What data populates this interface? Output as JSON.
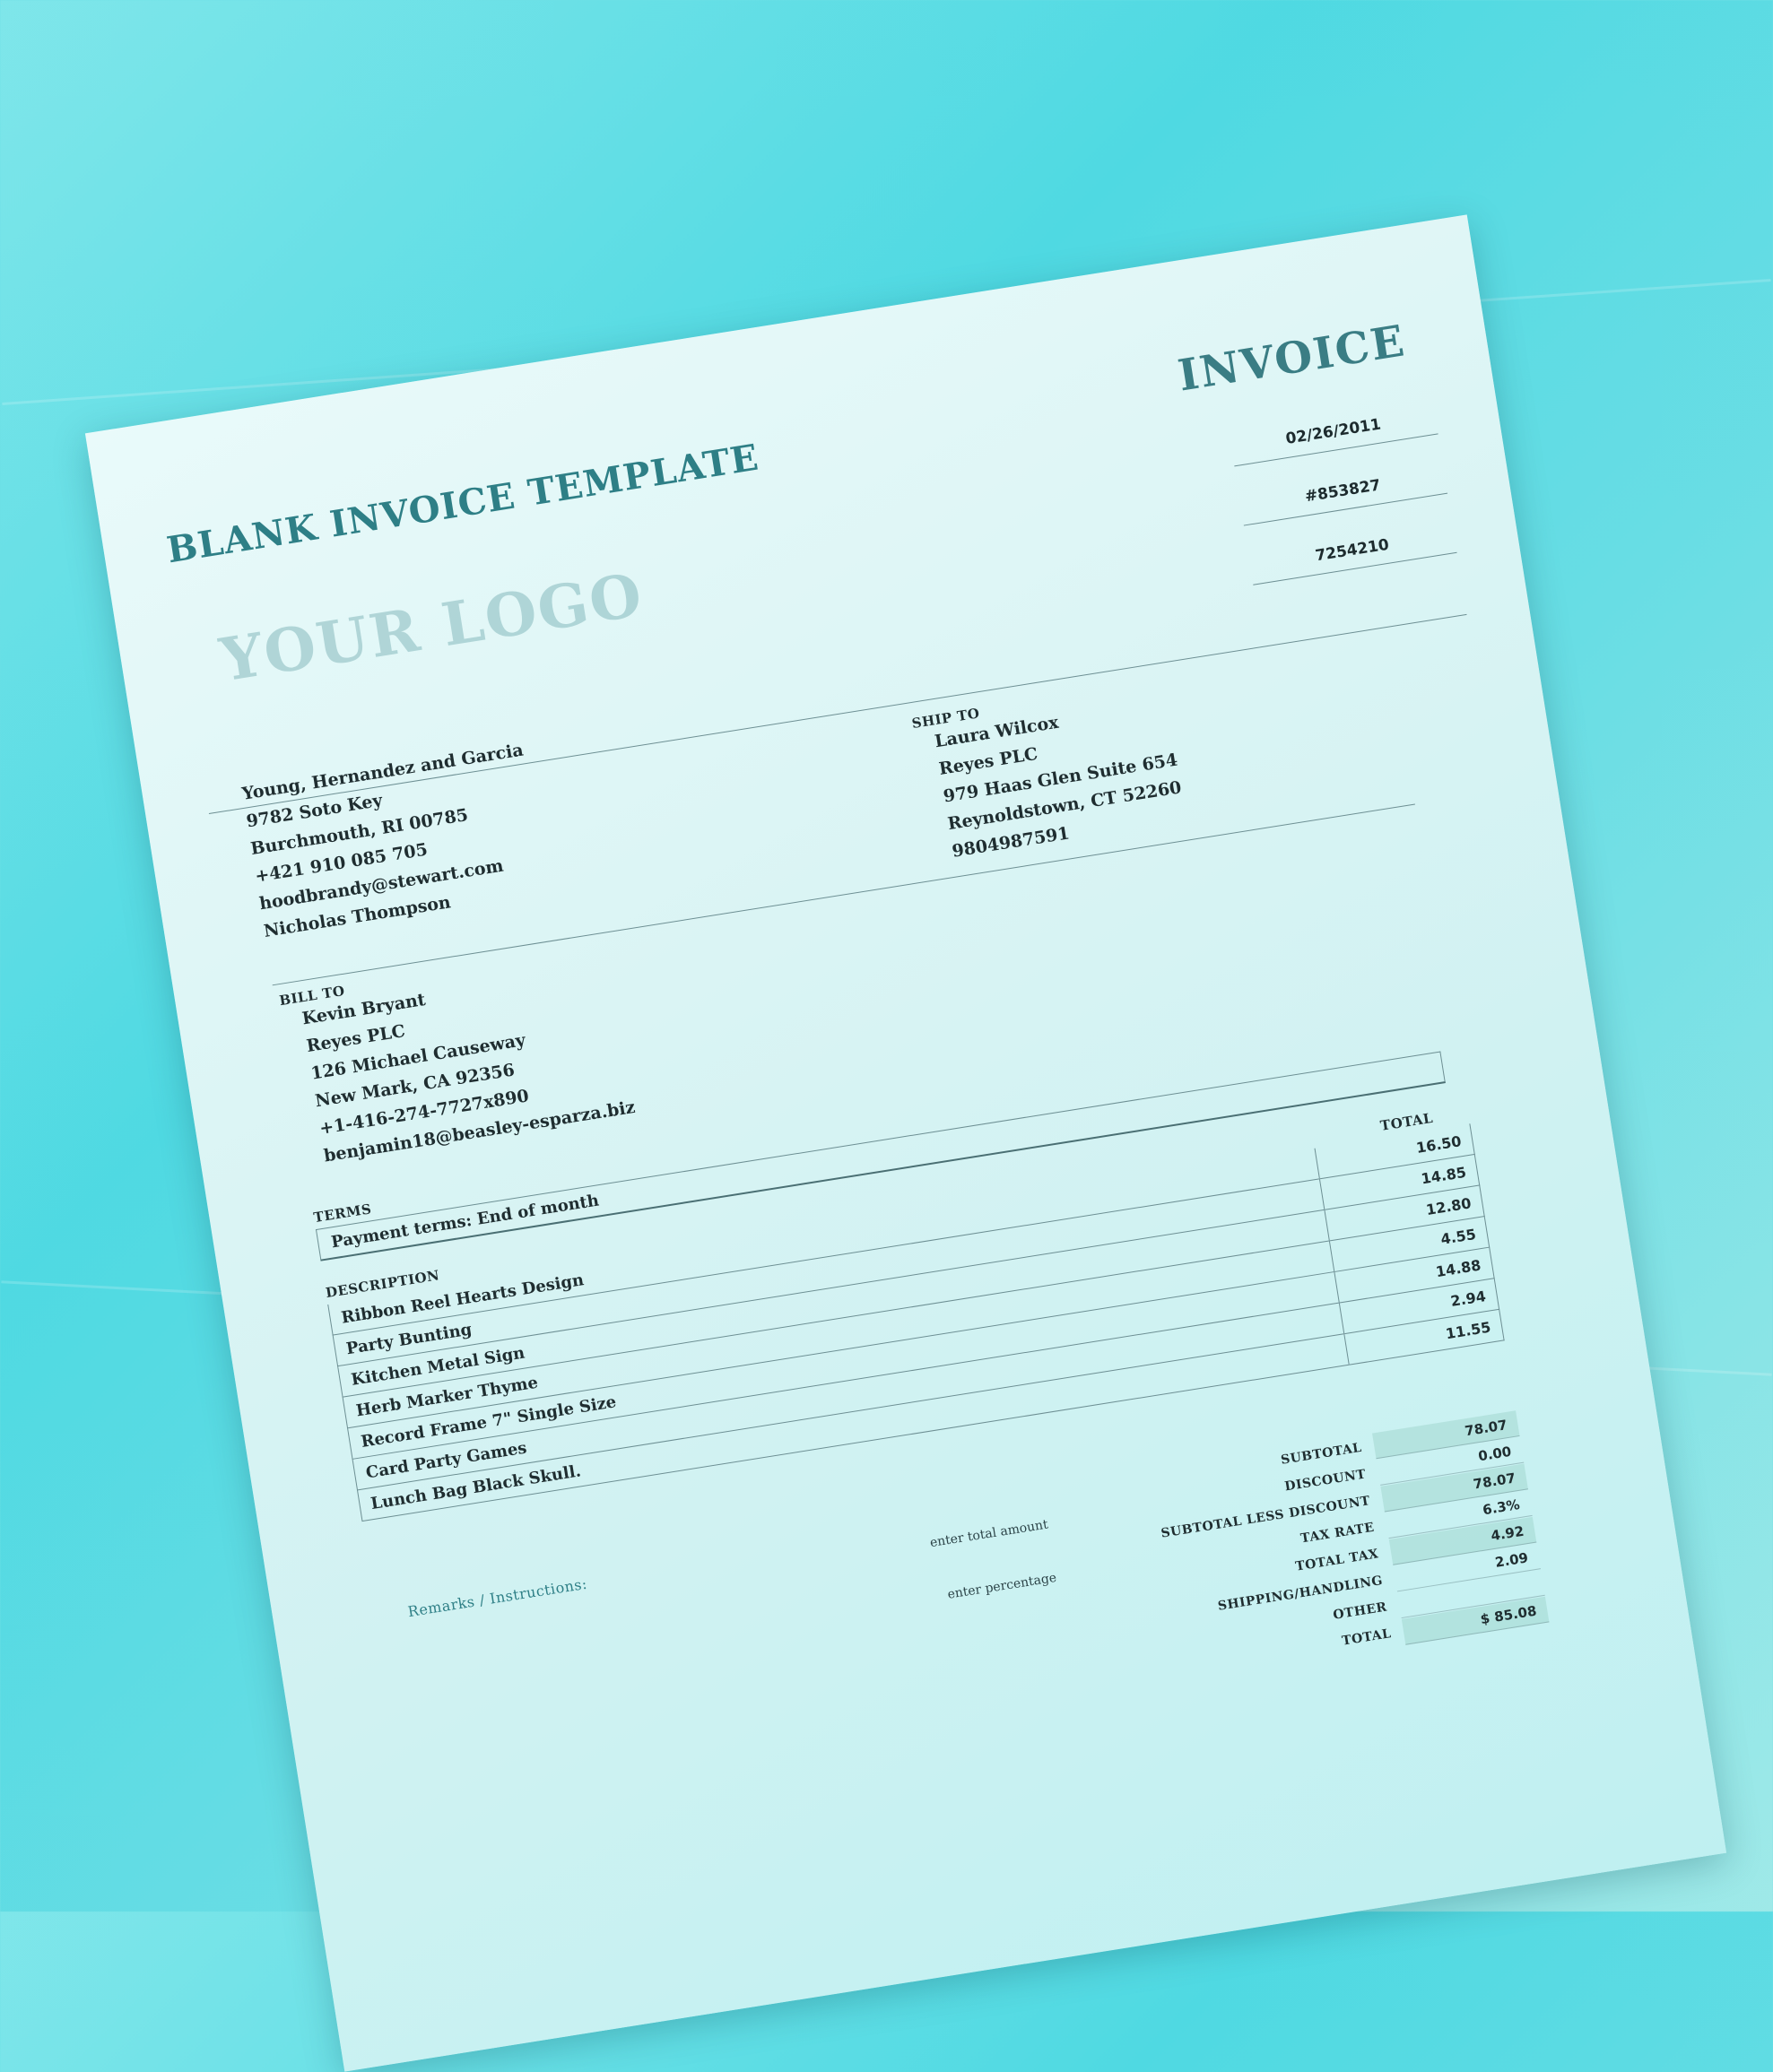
{
  "document": {
    "title": "BLANK INVOICE TEMPLATE",
    "heading": "INVOICE",
    "logo_placeholder": "YOUR LOGO"
  },
  "meta": {
    "date": "02/26/2011",
    "invoice_number": "#853827",
    "customer_id": "7254210"
  },
  "from": {
    "company": "Young, Hernandez and Garcia",
    "street": "9782 Soto Key",
    "city_state_zip": "Burchmouth, RI 00785",
    "phone": "+421 910 085 705",
    "email": "hoodbrandy@stewart.com",
    "contact": "Nicholas Thompson"
  },
  "ship_to": {
    "label": "SHIP TO",
    "name": "Laura Wilcox",
    "company": "Reyes PLC",
    "street": "979 Haas Glen Suite 654",
    "city_state_zip": "Reynoldstown, CT 52260",
    "phone": "9804987591"
  },
  "bill_to": {
    "label": "BILL TO",
    "name": "Kevin Bryant",
    "company": "Reyes PLC",
    "street": "126 Michael Causeway",
    "city_state_zip": "New Mark, CA 92356",
    "phone": "+1-416-274-7727x890",
    "email": "benjamin18@beasley-esparza.biz"
  },
  "terms": {
    "label": "TERMS",
    "text": "Payment terms: End of month"
  },
  "items": {
    "description_header": "DESCRIPTION",
    "total_header": "TOTAL",
    "rows": [
      {
        "description": "Ribbon Reel Hearts Design",
        "total": "16.50"
      },
      {
        "description": "Party Bunting",
        "total": "14.85"
      },
      {
        "description": "Kitchen Metal Sign",
        "total": "12.80"
      },
      {
        "description": "Herb Marker Thyme",
        "total": "4.55"
      },
      {
        "description": "Record Frame 7\" Single Size",
        "total": "14.88"
      },
      {
        "description": "Card Party Games",
        "total": "2.94"
      },
      {
        "description": "Lunch Bag Black Skull.",
        "total": "11.55"
      }
    ]
  },
  "summary": {
    "subtotal_label": "SUBTOTAL",
    "subtotal": "78.07",
    "discount_hint": "enter total amount",
    "discount_label": "DISCOUNT",
    "discount": "0.00",
    "subtotal_less_discount_label": "SUBTOTAL LESS DISCOUNT",
    "subtotal_less_discount": "78.07",
    "tax_rate_hint": "enter percentage",
    "tax_rate_label": "TAX RATE",
    "tax_rate": "6.3%",
    "total_tax_label": "TOTAL TAX",
    "total_tax": "4.92",
    "shipping_label": "SHIPPING/HANDLING",
    "shipping": "2.09",
    "other_label": "OTHER",
    "other": "",
    "total_label": "TOTAL",
    "total": "$ 85.08"
  },
  "remarks": {
    "label": "Remarks / Instructions:"
  }
}
